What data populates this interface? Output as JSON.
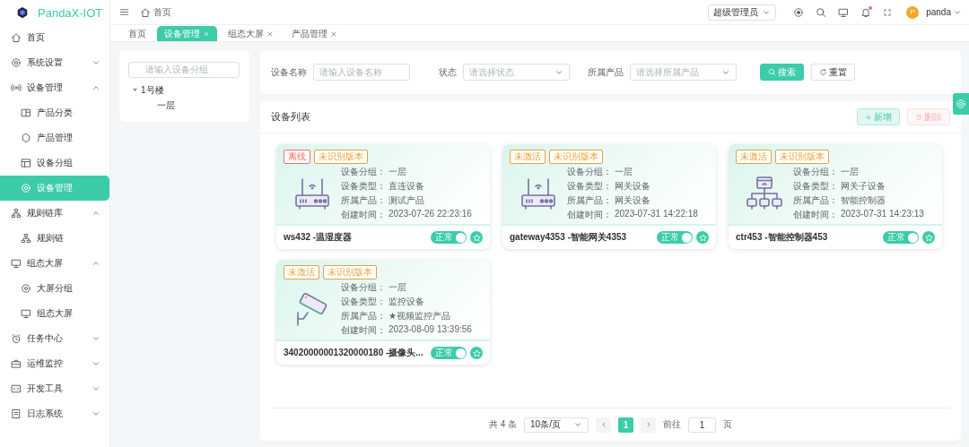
{
  "brand": {
    "name": "PandaX-IOT"
  },
  "header": {
    "breadcrumb": "首页",
    "role_select": "超级管理员",
    "avatar": "P",
    "user": "panda"
  },
  "tabs": [
    {
      "label": "首页",
      "selected": false,
      "closable": false
    },
    {
      "label": "设备管理",
      "selected": true,
      "closable": true
    },
    {
      "label": "组态大屏",
      "selected": false,
      "closable": true
    },
    {
      "label": "产品管理",
      "selected": false,
      "closable": true
    }
  ],
  "sidebar": {
    "items": [
      {
        "label": "首页",
        "selected": false
      },
      {
        "label": "系统设置",
        "selected": false,
        "expanded": false
      },
      {
        "label": "设备管理",
        "selected": false,
        "expanded": true,
        "children": [
          {
            "label": "产品分类",
            "selected": false
          },
          {
            "label": "产品管理",
            "selected": false
          },
          {
            "label": "设备分组",
            "selected": false
          },
          {
            "label": "设备管理",
            "selected": true
          }
        ]
      },
      {
        "label": "规则链库",
        "selected": false,
        "expanded": true,
        "children": [
          {
            "label": "规则链",
            "selected": false
          }
        ]
      },
      {
        "label": "组态大屏",
        "selected": false,
        "expanded": true,
        "children": [
          {
            "label": "大屏分组",
            "selected": false
          },
          {
            "label": "组态大屏",
            "selected": false
          }
        ]
      },
      {
        "label": "任务中心",
        "selected": false,
        "expanded": false
      },
      {
        "label": "运维监控",
        "selected": false,
        "expanded": false
      },
      {
        "label": "开发工具",
        "selected": false,
        "expanded": false
      },
      {
        "label": "日志系统",
        "selected": false,
        "expanded": false
      }
    ]
  },
  "group_tree": {
    "search": {
      "placeholder": "请输入设备分组"
    },
    "nodes": [
      {
        "label": "1号楼",
        "expanded": true,
        "children": [
          {
            "label": "一层"
          }
        ]
      }
    ]
  },
  "filters": {
    "fields": [
      {
        "kind": "input",
        "label": "设备名称",
        "placeholder": "请输入设备名称"
      },
      {
        "kind": "select",
        "label": "状态",
        "placeholder": "请选择状态"
      },
      {
        "kind": "select",
        "label": "所属产品",
        "placeholder": "请选择所属产品"
      }
    ],
    "buttons": [
      {
        "label": "搜索",
        "kind": "primary"
      },
      {
        "label": "重置",
        "kind": "plain"
      }
    ]
  },
  "device_list": {
    "title": "设备列表",
    "actions": [
      {
        "label": "新增",
        "kind": "add",
        "disabled": false
      },
      {
        "label": "删除",
        "kind": "delete",
        "disabled": true
      }
    ],
    "devices": [
      {
        "kind": "router",
        "tags": [
          {
            "label": "离线",
            "color": "#f56c6c"
          },
          {
            "label": "未识别版本",
            "color": "#e6a23c"
          }
        ],
        "fields": [
          {
            "label": "设备分组：",
            "value": "一层"
          },
          {
            "label": "设备类型：",
            "value": "直连设备"
          },
          {
            "label": "所属产品：",
            "value": "测试产品"
          },
          {
            "label": "创建时间：",
            "value": "2023-07-26 22:23:16"
          }
        ],
        "name": "ws432 -温湿度器",
        "status": "正常",
        "on": true
      },
      {
        "kind": "router",
        "tags": [
          {
            "label": "未激活",
            "color": "#e6a23c"
          },
          {
            "label": "未识别版本",
            "color": "#e6a23c"
          }
        ],
        "fields": [
          {
            "label": "设备分组：",
            "value": "一层"
          },
          {
            "label": "设备类型：",
            "value": "网关设备"
          },
          {
            "label": "所属产品：",
            "value": "网关设备"
          },
          {
            "label": "创建时间：",
            "value": "2023-07-31 14:22:18"
          }
        ],
        "name": "gateway4353 -智能网关4353",
        "status": "正常",
        "on": true
      },
      {
        "kind": "hub",
        "tags": [
          {
            "label": "未激活",
            "color": "#e6a23c"
          },
          {
            "label": "未识别版本",
            "color": "#e6a23c"
          }
        ],
        "fields": [
          {
            "label": "设备分组：",
            "value": "一层"
          },
          {
            "label": "设备类型：",
            "value": "网关子设备"
          },
          {
            "label": "所属产品：",
            "value": "智能控制器"
          },
          {
            "label": "创建时间：",
            "value": "2023-07-31 14:23:13"
          }
        ],
        "name": "ctr453 -智能控制器453",
        "status": "正常",
        "on": true
      },
      {
        "kind": "camera",
        "tags": [
          {
            "label": "未激活",
            "color": "#e6a23c"
          },
          {
            "label": "未识别版本",
            "color": "#e6a23c"
          }
        ],
        "fields": [
          {
            "label": "设备分组：",
            "value": "一层"
          },
          {
            "label": "设备类型：",
            "value": "监控设备"
          },
          {
            "label": "所属产品：",
            "value": "★视频监控产品"
          },
          {
            "label": "创建时间：",
            "value": "2023-08-09 13:39:56"
          }
        ],
        "name": "34020000001320000180 -摄像头...",
        "status": "正常",
        "on": true
      }
    ],
    "pagination": {
      "total": "共 4 条",
      "page_size": "10条/页",
      "pages": [
        {
          "label": "1",
          "selected": true
        }
      ],
      "goto_label": "前往",
      "goto_value": "1",
      "goto_unit": "页"
    }
  }
}
